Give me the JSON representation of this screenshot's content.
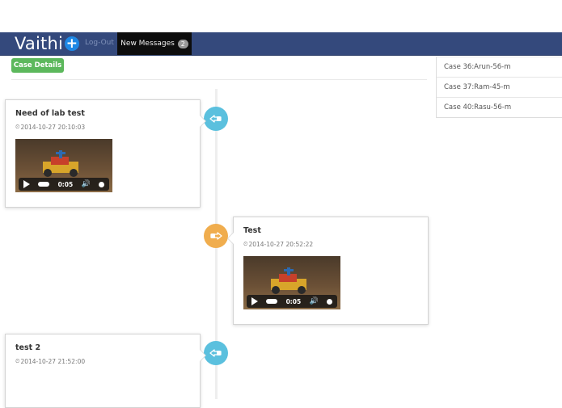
{
  "navbar": {
    "brand": "Vaithi",
    "brand_icon": "plus-icon",
    "logout_label": "Log-Out",
    "messages_label": "New Messages",
    "messages_count": "2"
  },
  "case_details_label": "Case Details",
  "case_list": [
    "Case 36:Arun-56-m",
    "Case 37:Ram-45-m",
    "Case 40:Rasu-56-m"
  ],
  "timeline": [
    {
      "title": "Need of lab test",
      "timestamp": "2014-10-27 20:10:03",
      "video_time": "0:05",
      "side": "left",
      "badge_icon": "hand-pointing-left-icon",
      "badge_color": "#5bc0de"
    },
    {
      "title": "Test",
      "timestamp": "2014-10-27 20:52:22",
      "video_time": "0:05",
      "side": "right",
      "badge_icon": "hand-pointing-right-icon",
      "badge_color": "#f0ad4e"
    },
    {
      "title": "test 2",
      "timestamp": "2014-10-27 21:52:00",
      "side": "left",
      "badge_icon": "hand-pointing-left-icon",
      "badge_color": "#5bc0de"
    }
  ],
  "colors": {
    "navbar": "#34497c",
    "success": "#5cb85c",
    "info": "#5bc0de",
    "warning": "#f0ad4e"
  }
}
